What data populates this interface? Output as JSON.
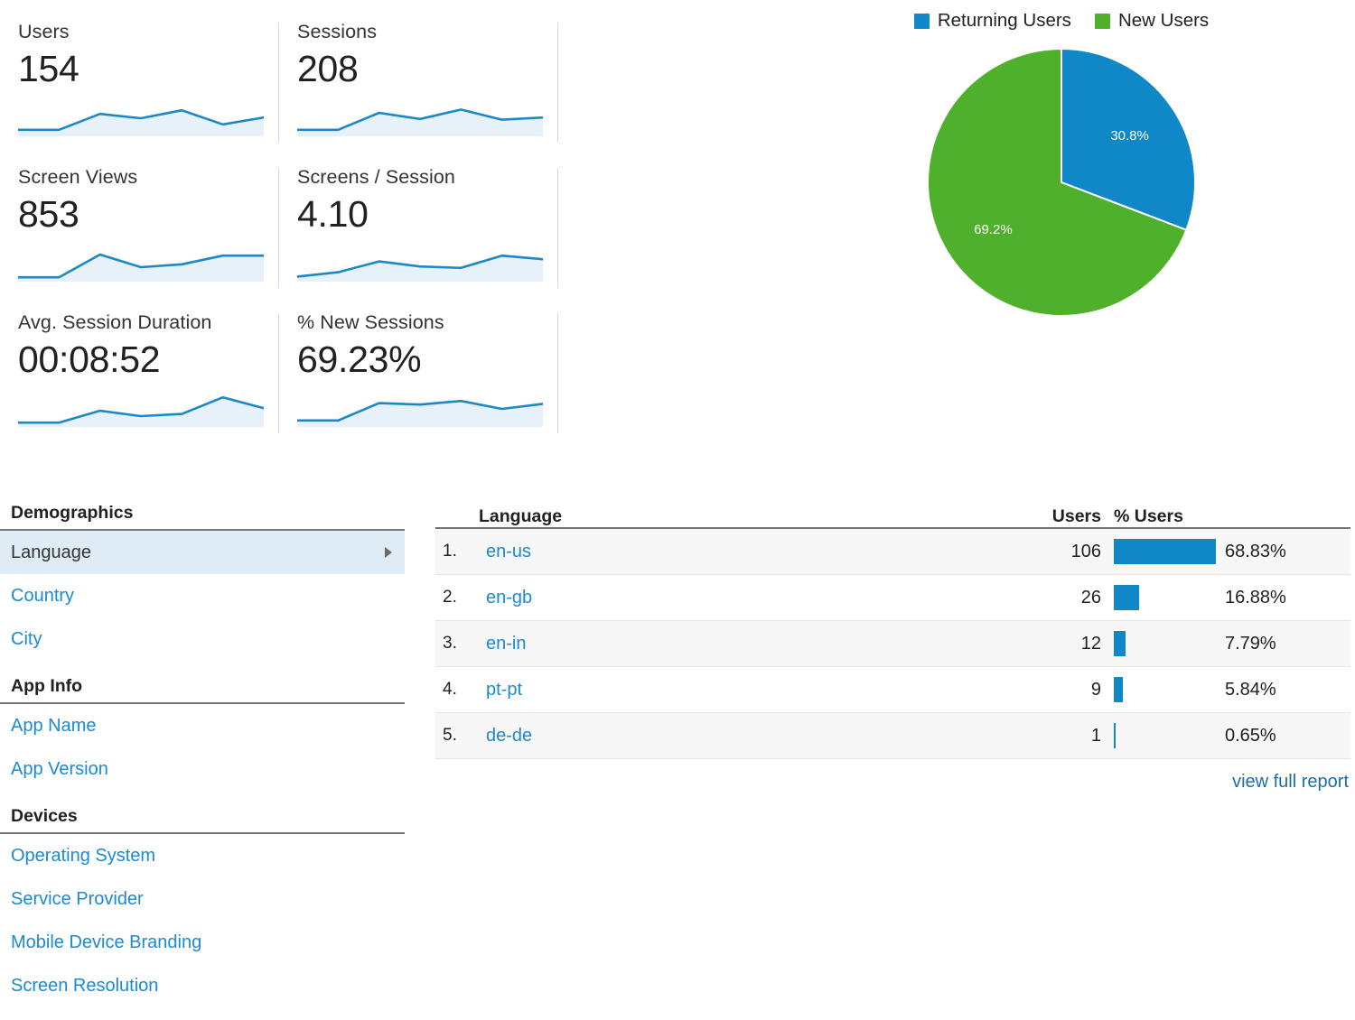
{
  "metrics": [
    {
      "label": "Users",
      "value": "154",
      "sparkline": [
        0.18,
        0.18,
        0.62,
        0.5,
        0.72,
        0.33,
        0.52
      ]
    },
    {
      "label": "Sessions",
      "value": "208",
      "sparkline": [
        0.18,
        0.18,
        0.65,
        0.48,
        0.74,
        0.46,
        0.52
      ]
    },
    {
      "label": "Screen Views",
      "value": "853",
      "sparkline": [
        0.12,
        0.12,
        0.75,
        0.4,
        0.48,
        0.72,
        0.72
      ]
    },
    {
      "label": "Screens / Session",
      "value": "4.10",
      "sparkline": [
        0.14,
        0.26,
        0.56,
        0.42,
        0.38,
        0.72,
        0.62
      ]
    },
    {
      "label": "Avg. Session Duration",
      "value": "00:08:52",
      "sparkline": [
        0.12,
        0.12,
        0.45,
        0.3,
        0.36,
        0.82,
        0.52
      ]
    },
    {
      "label": "% New Sessions",
      "value": "69.23%",
      "sparkline": [
        0.18,
        0.18,
        0.66,
        0.62,
        0.72,
        0.5,
        0.64
      ]
    }
  ],
  "pie": {
    "legend": [
      {
        "label": "Returning Users",
        "color": "#1087c6"
      },
      {
        "label": "New Users",
        "color": "#4fb02b"
      }
    ],
    "slice_labels": [
      "30.8%",
      "69.2%"
    ]
  },
  "chart_data": [
    {
      "type": "pie",
      "title": "",
      "categories": [
        "Returning Users",
        "New Users"
      ],
      "values": [
        30.8,
        69.2
      ],
      "unit": "%",
      "colors": [
        "#1087c6",
        "#4fb02b"
      ],
      "legend_position": "top",
      "annotations": [
        "30.8%",
        "69.2%"
      ],
      "start_angle_deg": 0,
      "direction": "clockwise"
    },
    {
      "type": "bar",
      "title": "Language",
      "categories": [
        "en-us",
        "en-gb",
        "en-in",
        "pt-pt",
        "de-de"
      ],
      "series": [
        {
          "name": "Users",
          "values": [
            106,
            26,
            12,
            9,
            1
          ]
        },
        {
          "name": "% Users",
          "values": [
            68.83,
            16.88,
            7.79,
            5.84,
            0.65
          ]
        }
      ],
      "xlabel": "Language",
      "ylabel": "% Users",
      "ylim": [
        0,
        68.83
      ],
      "grid": false,
      "legend_position": "none"
    },
    {
      "type": "line",
      "title": "Metric sparklines",
      "x": [
        1,
        2,
        3,
        4,
        5,
        6,
        7
      ],
      "series": [
        {
          "name": "Users",
          "values": [
            0.18,
            0.18,
            0.62,
            0.5,
            0.72,
            0.33,
            0.52
          ]
        },
        {
          "name": "Sessions",
          "values": [
            0.18,
            0.18,
            0.65,
            0.48,
            0.74,
            0.46,
            0.52
          ]
        },
        {
          "name": "Screen Views",
          "values": [
            0.12,
            0.12,
            0.75,
            0.4,
            0.48,
            0.72,
            0.72
          ]
        },
        {
          "name": "Screens / Session",
          "values": [
            0.14,
            0.26,
            0.56,
            0.42,
            0.38,
            0.72,
            0.62
          ]
        },
        {
          "name": "Avg. Session Duration",
          "values": [
            0.12,
            0.12,
            0.45,
            0.3,
            0.36,
            0.82,
            0.52
          ]
        },
        {
          "name": "% New Sessions",
          "values": [
            0.18,
            0.18,
            0.66,
            0.62,
            0.72,
            0.5,
            0.64
          ]
        }
      ],
      "xlabel": "",
      "ylabel": "",
      "grid": false,
      "legend_position": "none"
    }
  ],
  "dimension_nav": {
    "groups": [
      {
        "title": "Demographics",
        "items": [
          {
            "label": "Language",
            "selected": true,
            "has_caret": true
          },
          {
            "label": "Country",
            "selected": false,
            "has_caret": false
          },
          {
            "label": "City",
            "selected": false,
            "has_caret": false
          }
        ]
      },
      {
        "title": "App Info",
        "items": [
          {
            "label": "App Name",
            "selected": false,
            "has_caret": false
          },
          {
            "label": "App Version",
            "selected": false,
            "has_caret": false
          }
        ]
      },
      {
        "title": "Devices",
        "items": [
          {
            "label": "Operating System",
            "selected": false,
            "has_caret": false
          },
          {
            "label": "Service Provider",
            "selected": false,
            "has_caret": false
          },
          {
            "label": "Mobile Device Branding",
            "selected": false,
            "has_caret": false
          },
          {
            "label": "Screen Resolution",
            "selected": false,
            "has_caret": false
          }
        ]
      }
    ]
  },
  "language_table": {
    "columns": {
      "language": "Language",
      "users": "Users",
      "pct_users": "% Users"
    },
    "rows": [
      {
        "rank": "1.",
        "language": "en-us",
        "users": "106",
        "pct": "68.83%",
        "pct_value": 68.83
      },
      {
        "rank": "2.",
        "language": "en-gb",
        "users": "26",
        "pct": "16.88%",
        "pct_value": 16.88
      },
      {
        "rank": "3.",
        "language": "en-in",
        "users": "12",
        "pct": "7.79%",
        "pct_value": 7.79
      },
      {
        "rank": "4.",
        "language": "pt-pt",
        "users": "9",
        "pct": "5.84%",
        "pct_value": 5.84
      },
      {
        "rank": "5.",
        "language": "de-de",
        "users": "1",
        "pct": "0.65%",
        "pct_value": 0.65
      }
    ],
    "footer_link": "view full report"
  },
  "colors": {
    "accent_blue": "#1087c6",
    "accent_green": "#4fb02b",
    "link_blue": "#1a8ad4",
    "sparkline_line": "#1e88c7",
    "sparkline_fill": "#e7f1fa"
  }
}
